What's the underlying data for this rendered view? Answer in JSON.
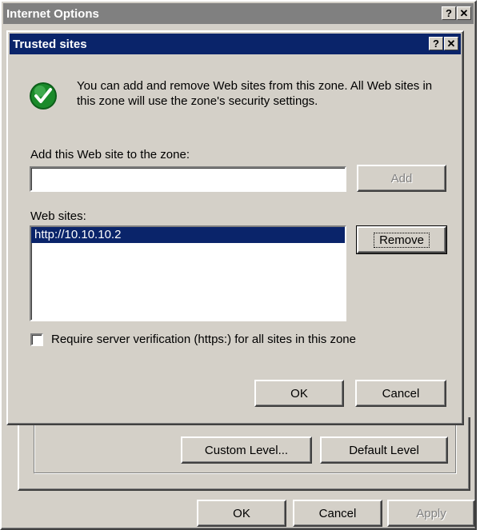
{
  "parent_window": {
    "title": "Internet Options",
    "help_glyph": "?",
    "close_glyph": "✕",
    "custom_level_label": "Custom Level...",
    "default_level_label": "Default Level",
    "ok_label": "OK",
    "cancel_label": "Cancel",
    "apply_label": "Apply"
  },
  "dialog": {
    "title": "Trusted sites",
    "help_glyph": "?",
    "close_glyph": "✕",
    "info_icon": "check-icon",
    "info_text": "You can add and remove Web sites from this zone. All Web sites in this zone will use the zone's security settings.",
    "add_label": "Add this Web site to the zone:",
    "add_input_value": "",
    "add_button_label": "Add",
    "websites_label": "Web sites:",
    "websites": [
      "http://10.10.10.2"
    ],
    "remove_button_label": "Remove",
    "require_https_label": "Require server verification (https:) for all sites in this zone",
    "require_https_checked": false,
    "ok_label": "OK",
    "cancel_label": "Cancel"
  },
  "colors": {
    "active_title": "#0a246a",
    "inactive_title": "#808080",
    "face": "#d4d0c8",
    "selection": "#0a246a",
    "check_green": "#1a8a2a"
  }
}
